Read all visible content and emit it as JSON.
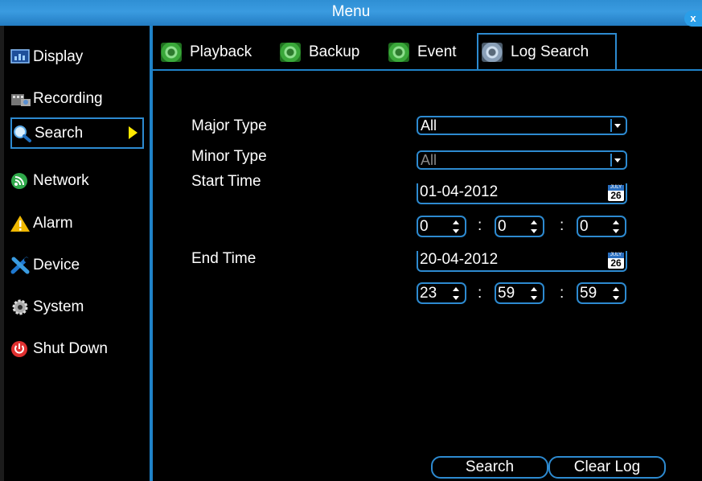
{
  "window": {
    "title": "Menu",
    "close_label": "x"
  },
  "sidebar": {
    "items": [
      {
        "label": "Display",
        "icon": "display-icon"
      },
      {
        "label": "Recording",
        "icon": "recording-icon"
      },
      {
        "label": "Search",
        "icon": "search-icon",
        "active": true
      },
      {
        "label": "Network",
        "icon": "network-icon"
      },
      {
        "label": "Alarm",
        "icon": "alarm-icon"
      },
      {
        "label": "Device",
        "icon": "device-icon"
      },
      {
        "label": "System",
        "icon": "system-icon"
      },
      {
        "label": "Shut Down",
        "icon": "power-icon"
      }
    ]
  },
  "tabs": [
    {
      "label": "Playback",
      "icon": "gear-icon"
    },
    {
      "label": "Backup",
      "icon": "gear-icon"
    },
    {
      "label": "Event",
      "icon": "gear-icon"
    },
    {
      "label": "Log Search",
      "icon": "gear-icon",
      "active": true
    }
  ],
  "form": {
    "major_type": {
      "label": "Major Type",
      "value": "All"
    },
    "minor_type": {
      "label": "Minor Type",
      "value": "All",
      "disabled": true
    },
    "start_time": {
      "label": "Start Time",
      "date": "01-04-2012",
      "hour": "0",
      "minute": "0",
      "second": "0"
    },
    "end_time": {
      "label": "End Time",
      "date": "20-04-2012",
      "hour": "23",
      "minute": "59",
      "second": "59"
    },
    "calendar_icon": {
      "month": "JULY",
      "day": "26"
    },
    "time_separator": ":"
  },
  "buttons": {
    "search": "Search",
    "clear_log": "Clear Log"
  },
  "colors": {
    "accent": "#2d8ad0",
    "title_bar": "#2f8fd4",
    "active_arrow": "#ffe900",
    "background": "#000000"
  }
}
